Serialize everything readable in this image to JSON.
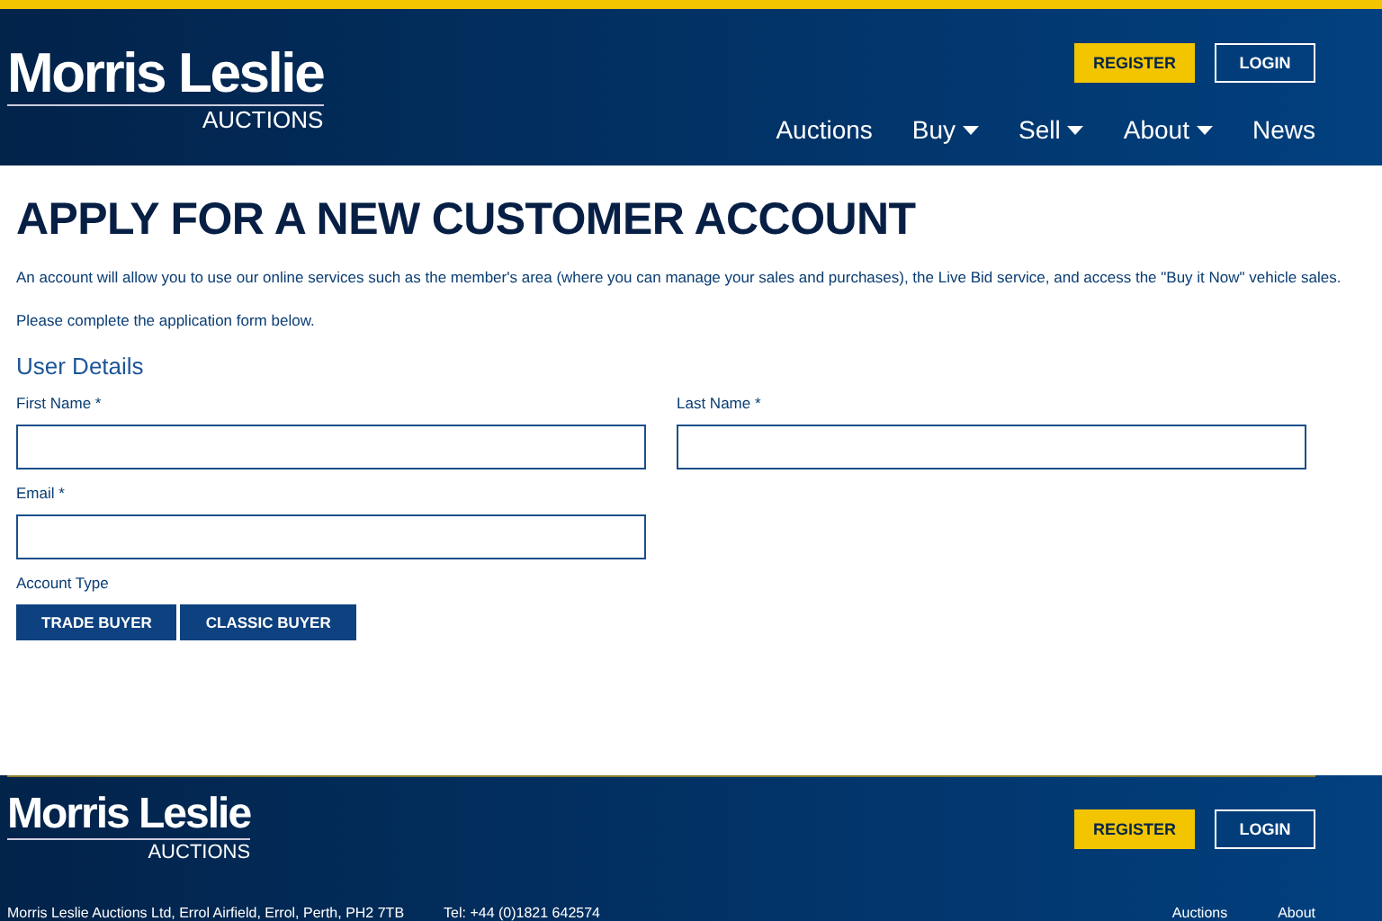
{
  "header": {
    "logo": {
      "name": "Morris Leslie",
      "sub": "AUCTIONS"
    },
    "buttons": [
      {
        "label": "REGISTER",
        "kind": "primary"
      },
      {
        "label": "LOGIN",
        "kind": "outline"
      }
    ],
    "nav": [
      {
        "label": "Auctions",
        "dropdown": false
      },
      {
        "label": "Buy",
        "dropdown": true
      },
      {
        "label": "Sell",
        "dropdown": true
      },
      {
        "label": "About",
        "dropdown": true
      },
      {
        "label": "News",
        "dropdown": false
      }
    ]
  },
  "main": {
    "title": "APPLY FOR A NEW CUSTOMER ACCOUNT",
    "intro": "An account will allow you to use our online services such as the member's area (where you can manage your sales and purchases), the Live Bid service, and access the \"Buy it Now\" vehicle sales.",
    "note": "Please complete the application form below.",
    "section": "User Details",
    "fields": [
      {
        "label": "First Name *"
      },
      {
        "label": "Last Name *"
      },
      {
        "label": "Email *"
      }
    ],
    "account_type": {
      "label": "Account Type",
      "options": [
        "TRADE BUYER",
        "CLASSIC BUYER"
      ]
    }
  },
  "footer": {
    "logo": {
      "name": "Morris Leslie",
      "sub": "AUCTIONS"
    },
    "buttons": [
      {
        "label": "REGISTER",
        "kind": "primary"
      },
      {
        "label": "LOGIN",
        "kind": "outline"
      }
    ],
    "address": "Morris Leslie Auctions Ltd, Errol Airfield, Errol, Perth, PH2 7TB",
    "phone": "Tel: +44 (0)1821 642574",
    "links": [
      "Auctions",
      "About"
    ]
  }
}
